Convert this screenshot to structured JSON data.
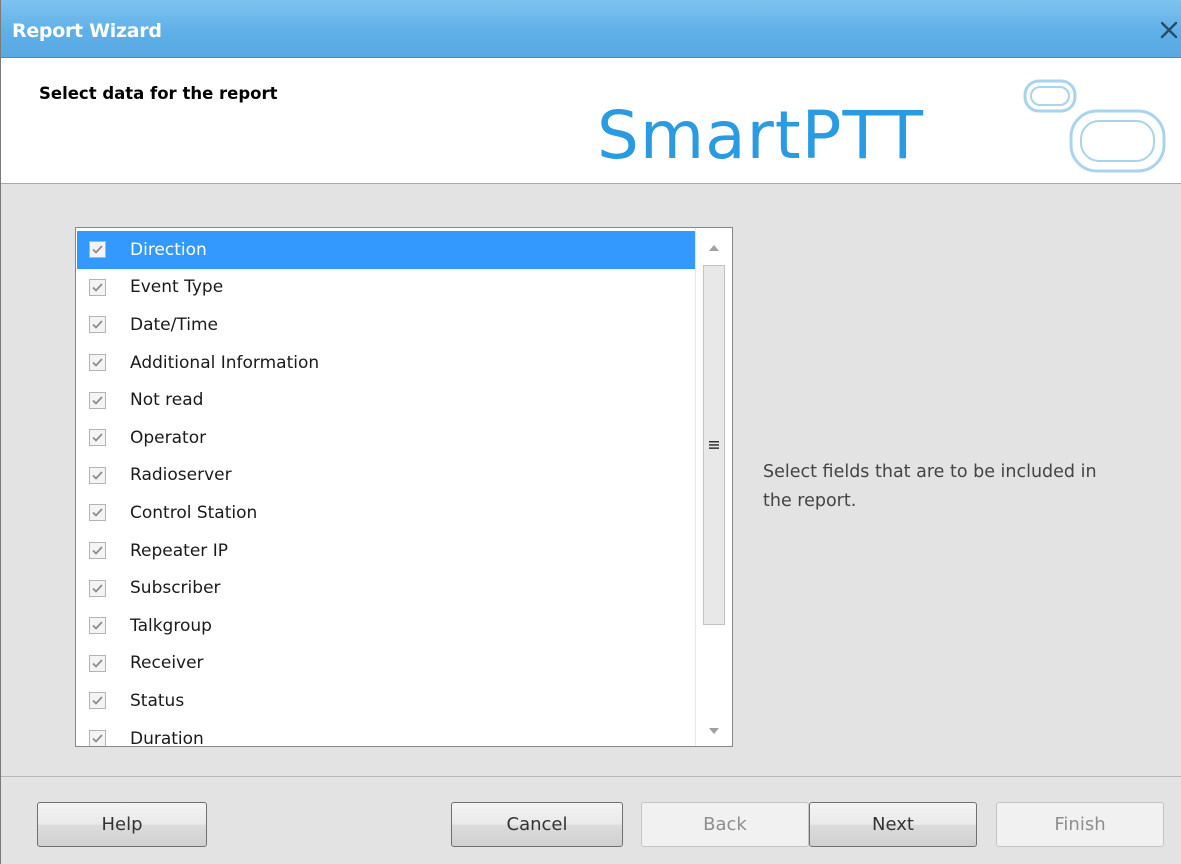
{
  "window": {
    "title": "Report Wizard",
    "close_glyph": "✕"
  },
  "header": {
    "subtitle": "Select data for the report",
    "logo_text": "SmartPTT"
  },
  "list": {
    "items": [
      {
        "label": "Direction",
        "checked": true,
        "selected": true
      },
      {
        "label": "Event Type",
        "checked": true
      },
      {
        "label": "Date/Time",
        "checked": true
      },
      {
        "label": "Additional Information",
        "checked": true
      },
      {
        "label": "Not read",
        "checked": true
      },
      {
        "label": "Operator",
        "checked": true
      },
      {
        "label": "Radioserver",
        "checked": true
      },
      {
        "label": "Control Station",
        "checked": true
      },
      {
        "label": "Repeater IP",
        "checked": true
      },
      {
        "label": "Subscriber",
        "checked": true
      },
      {
        "label": "Talkgroup",
        "checked": true
      },
      {
        "label": "Receiver",
        "checked": true
      },
      {
        "label": "Status",
        "checked": true
      },
      {
        "label": "Duration",
        "checked": true
      }
    ]
  },
  "hint": {
    "text": "Select fields that are to be included in the report."
  },
  "buttons": {
    "help": "Help",
    "cancel": "Cancel",
    "back": "Back",
    "next": "Next",
    "finish": "Finish"
  },
  "colors": {
    "titlebar": "#5fb0e8",
    "selection": "#3399ff",
    "logo_blue": "#2a9be0"
  }
}
